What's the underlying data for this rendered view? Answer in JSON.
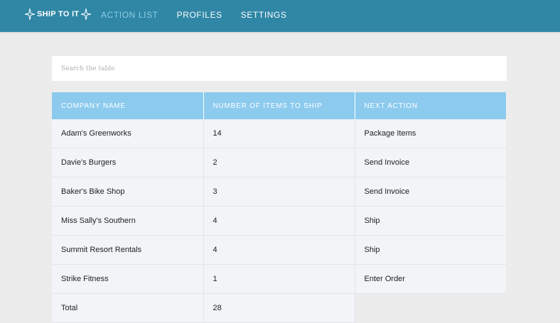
{
  "app": {
    "logo_text": "SHIP TO IT"
  },
  "nav": {
    "items": [
      {
        "label": "ACTION LIST",
        "active": true
      },
      {
        "label": "PROFILES",
        "active": false
      },
      {
        "label": "SETTINGS",
        "active": false
      }
    ]
  },
  "search": {
    "placeholder": "Search the table",
    "value": ""
  },
  "table": {
    "headers": [
      "COMPANY NAME",
      "NUMBER OF ITEMS TO SHIP",
      "NEXT ACTION"
    ],
    "rows": [
      {
        "company": "Adam's Greenworks",
        "items": "14",
        "action": "Package Items"
      },
      {
        "company": "Davie's Burgers",
        "items": "2",
        "action": "Send Invoice"
      },
      {
        "company": "Baker's Bike Shop",
        "items": "3",
        "action": "Send Invoice"
      },
      {
        "company": "Miss Sally's Southern",
        "items": "4",
        "action": "Ship"
      },
      {
        "company": "Summit Resort Rentals",
        "items": "4",
        "action": "Ship"
      },
      {
        "company": "Strike Fitness",
        "items": "1",
        "action": "Enter Order"
      }
    ],
    "total": {
      "label": "Total",
      "items": "28"
    }
  },
  "colors": {
    "topbar": "#2f86a5",
    "nav_active": "#8fcde6",
    "table_header": "#8ccaee",
    "row_background": "#f2f4f7",
    "page_background": "#ececec"
  }
}
